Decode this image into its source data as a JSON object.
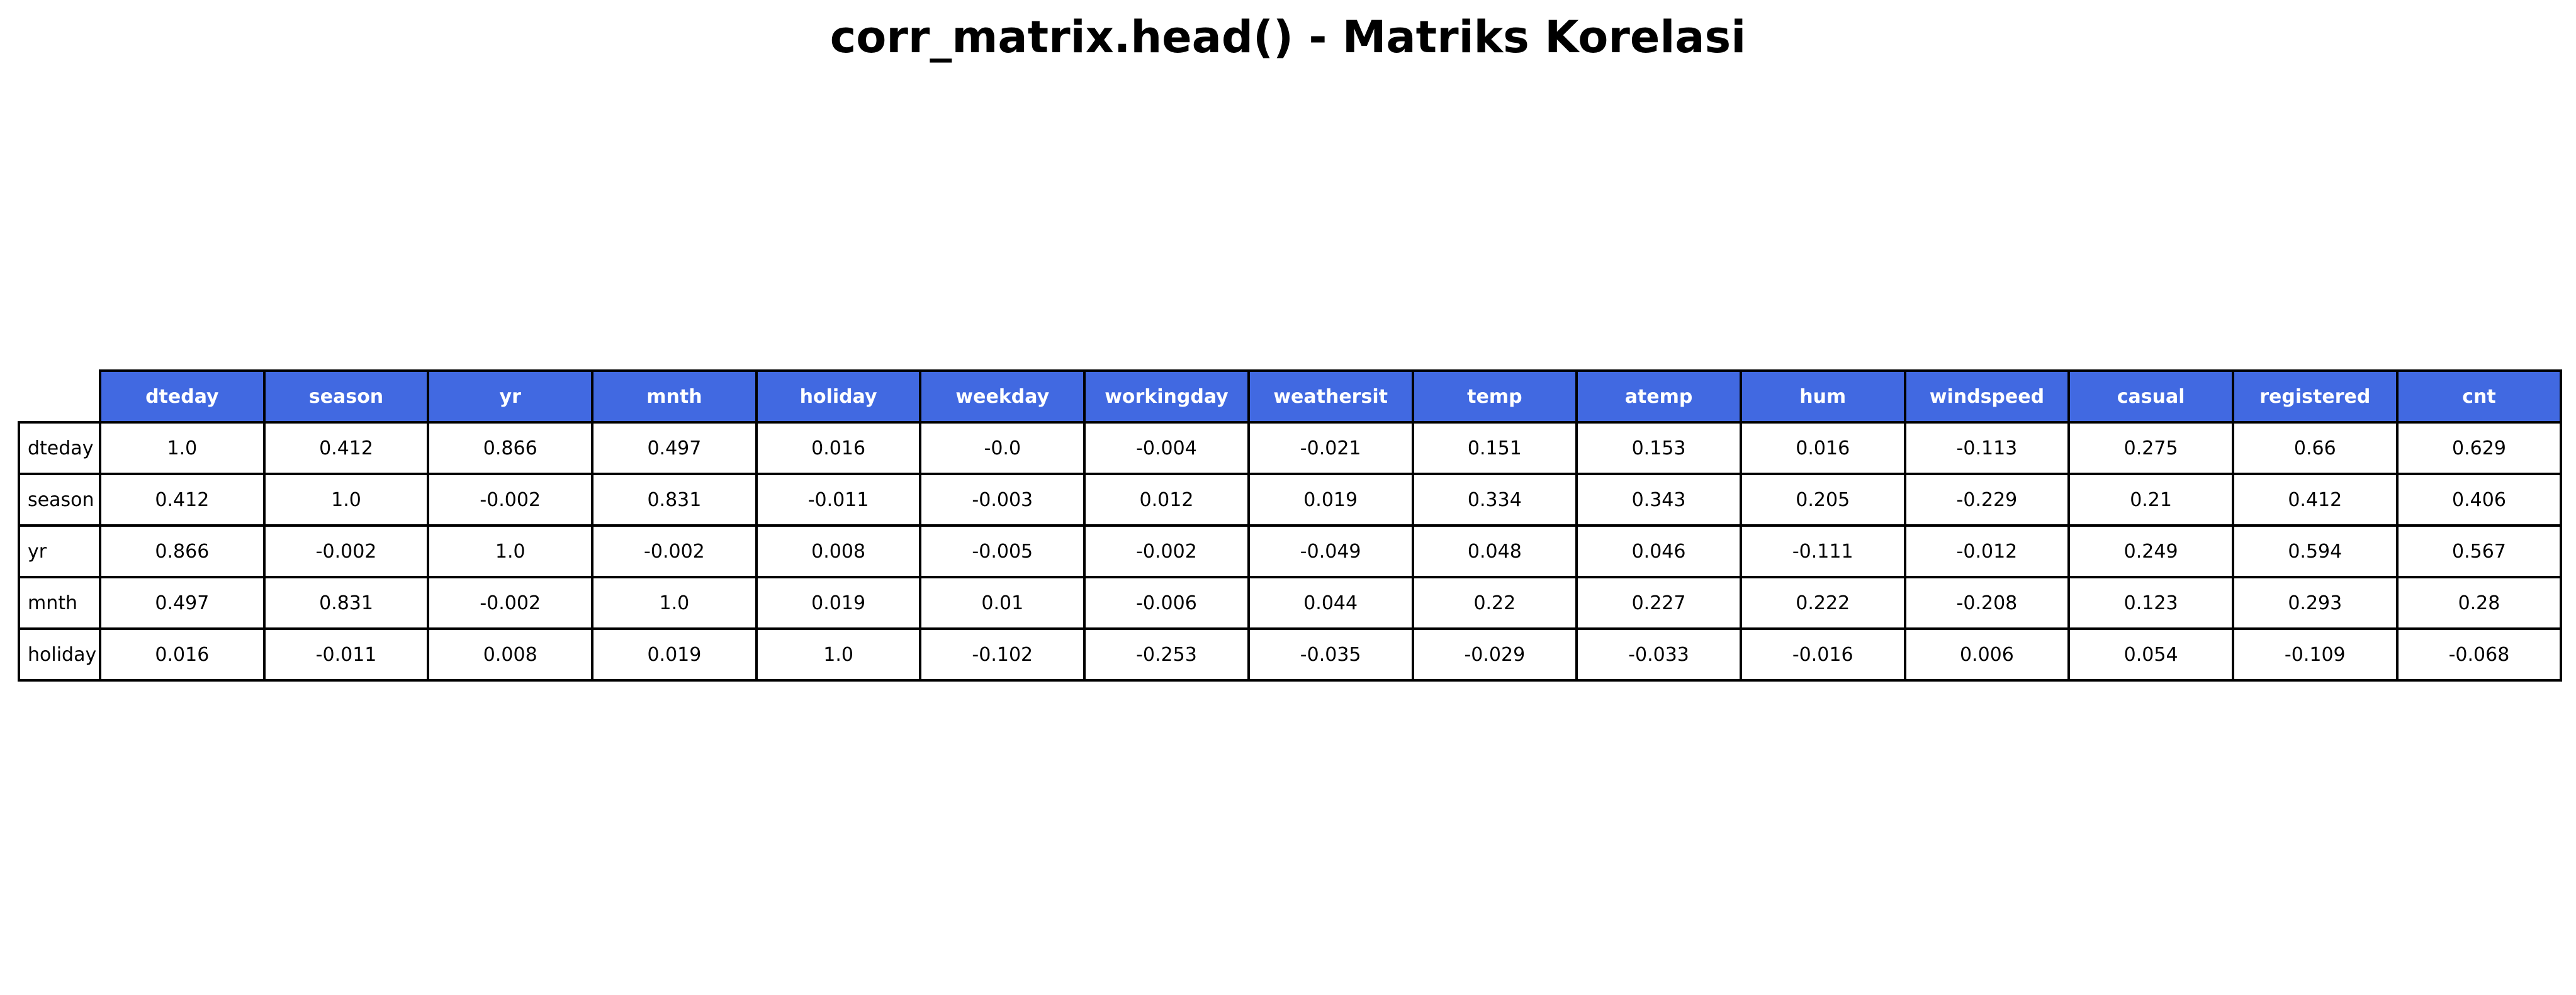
{
  "chart_data": {
    "type": "table",
    "title": "corr_matrix.head() - Matriks Korelasi",
    "header_color": "#4169e1",
    "header_text_color": "#ffffff",
    "columns": [
      "dteday",
      "season",
      "yr",
      "mnth",
      "holiday",
      "weekday",
      "workingday",
      "weathersit",
      "temp",
      "atemp",
      "hum",
      "windspeed",
      "casual",
      "registered",
      "cnt"
    ],
    "rows": [
      {
        "label": "dteday",
        "values": [
          "1.0",
          "0.412",
          "0.866",
          "0.497",
          "0.016",
          "-0.0",
          "-0.004",
          "-0.021",
          "0.151",
          "0.153",
          "0.016",
          "-0.113",
          "0.275",
          "0.66",
          "0.629"
        ]
      },
      {
        "label": "season",
        "values": [
          "0.412",
          "1.0",
          "-0.002",
          "0.831",
          "-0.011",
          "-0.003",
          "0.012",
          "0.019",
          "0.334",
          "0.343",
          "0.205",
          "-0.229",
          "0.21",
          "0.412",
          "0.406"
        ]
      },
      {
        "label": "yr",
        "values": [
          "0.866",
          "-0.002",
          "1.0",
          "-0.002",
          "0.008",
          "-0.005",
          "-0.002",
          "-0.049",
          "0.048",
          "0.046",
          "-0.111",
          "-0.012",
          "0.249",
          "0.594",
          "0.567"
        ]
      },
      {
        "label": "mnth",
        "values": [
          "0.497",
          "0.831",
          "-0.002",
          "1.0",
          "0.019",
          "0.01",
          "-0.006",
          "0.044",
          "0.22",
          "0.227",
          "0.222",
          "-0.208",
          "0.123",
          "0.293",
          "0.28"
        ]
      },
      {
        "label": "holiday",
        "values": [
          "0.016",
          "-0.011",
          "0.008",
          "0.019",
          "1.0",
          "-0.102",
          "-0.253",
          "-0.035",
          "-0.029",
          "-0.033",
          "-0.016",
          "0.006",
          "0.054",
          "-0.109",
          "-0.068"
        ]
      }
    ]
  }
}
